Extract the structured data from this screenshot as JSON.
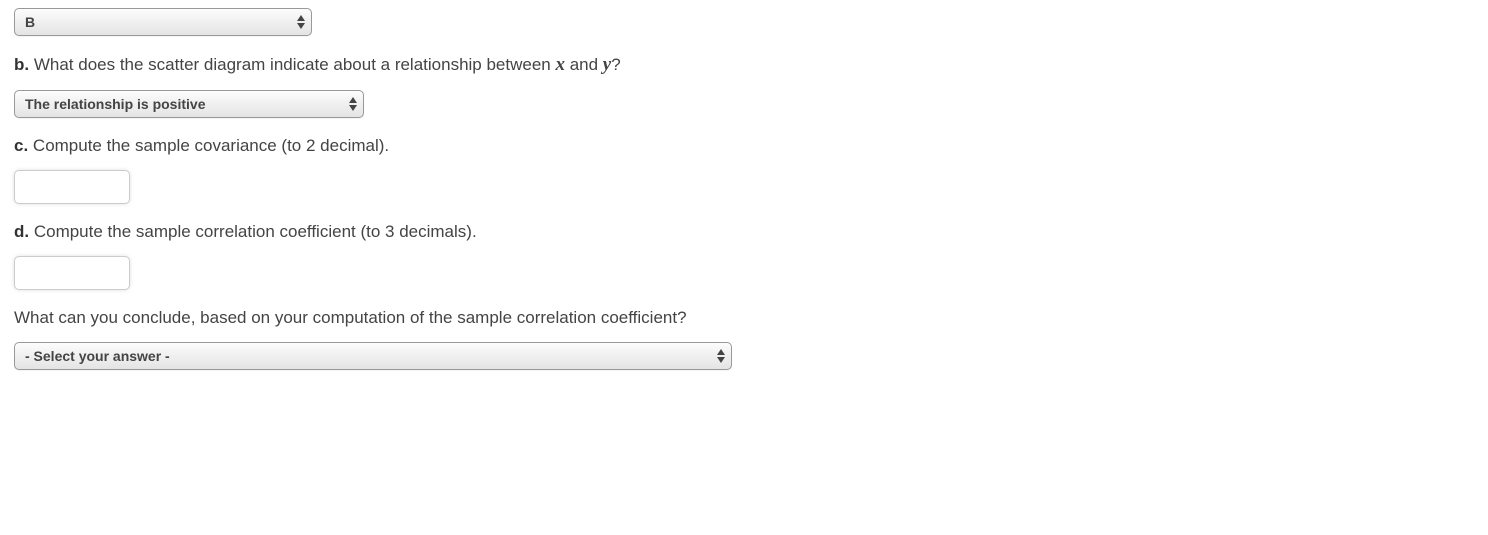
{
  "dropdown_a": {
    "value": "B"
  },
  "question_b": {
    "label": "b.",
    "text_before": " What does the scatter diagram indicate about a relationship between ",
    "var1": "x",
    "text_mid": " and ",
    "var2": "y",
    "text_after": "?"
  },
  "dropdown_b": {
    "value": "The relationship is positive"
  },
  "question_c": {
    "label": "c.",
    "text": " Compute the sample covariance (to 2 decimal)."
  },
  "input_c": {
    "value": ""
  },
  "question_d": {
    "label": "d.",
    "text": " Compute the sample correlation coefficient (to 3 decimals)."
  },
  "input_d": {
    "value": ""
  },
  "question_e": {
    "text": "What can you conclude, based on your computation of the sample correlation coefficient?"
  },
  "dropdown_e": {
    "value": "- Select your answer -"
  }
}
